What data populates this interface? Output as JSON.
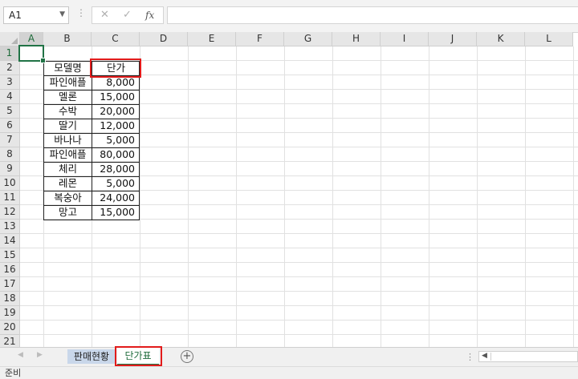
{
  "formula_bar": {
    "name_box": "A1",
    "dropdown_icon": "chevron-down-icon",
    "cancel_icon": "close-icon",
    "confirm_icon": "check-icon",
    "function_label": "fx",
    "formula": ""
  },
  "columns": [
    "A",
    "B",
    "C",
    "D",
    "E",
    "F",
    "G",
    "H",
    "I",
    "J",
    "K",
    "L"
  ],
  "rows": [
    "1",
    "2",
    "3",
    "4",
    "5",
    "6",
    "7",
    "8",
    "9",
    "10",
    "11",
    "12",
    "13",
    "14",
    "15",
    "16",
    "17",
    "18",
    "19",
    "20",
    "21"
  ],
  "table": {
    "headers": [
      "모델명",
      "단가"
    ],
    "items": [
      {
        "model": "파인애플",
        "price": "8,000"
      },
      {
        "model": "멜론",
        "price": "15,000"
      },
      {
        "model": "수박",
        "price": "20,000"
      },
      {
        "model": "딸기",
        "price": "12,000"
      },
      {
        "model": "바나나",
        "price": "5,000"
      },
      {
        "model": "파인애플",
        "price": "80,000"
      },
      {
        "model": "체리",
        "price": "28,000"
      },
      {
        "model": "레몬",
        "price": "5,000"
      },
      {
        "model": "복숭아",
        "price": "24,000"
      },
      {
        "model": "망고",
        "price": "15,000"
      }
    ]
  },
  "sheet_tabs": [
    "판매현황",
    "단가표"
  ],
  "add_sheet_label": "⊕",
  "status_text": "준비",
  "colors": {
    "accent": "#217346",
    "highlight": "#e21b1b"
  }
}
